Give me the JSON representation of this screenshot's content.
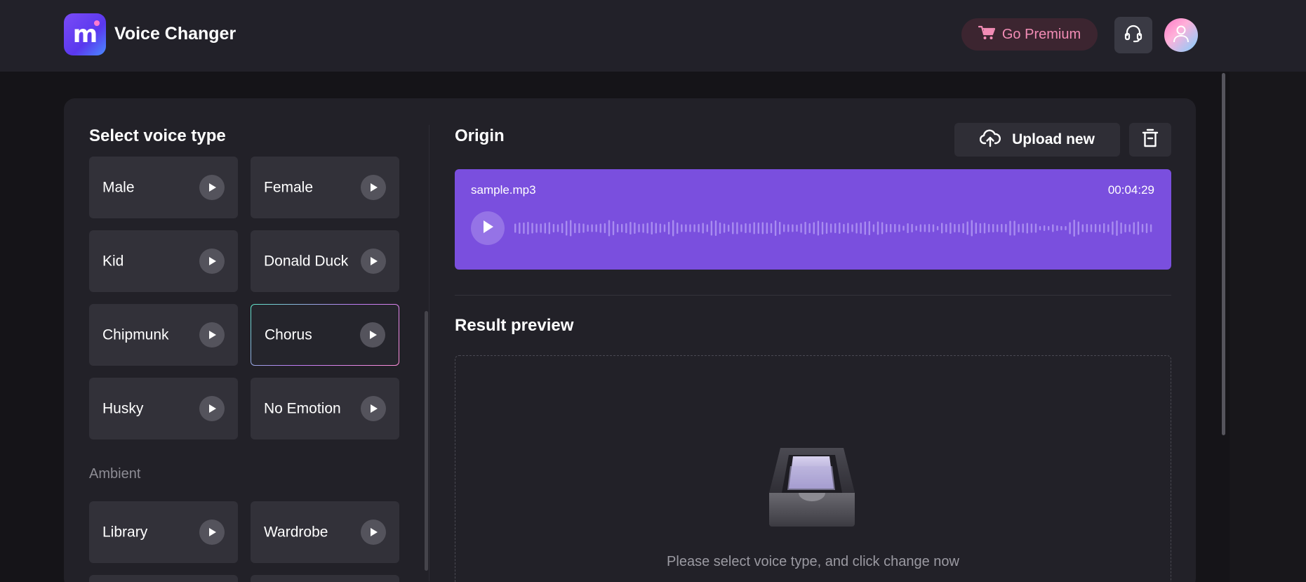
{
  "header": {
    "logo_letter": "m",
    "app_title": "Voice Changer",
    "premium_label": "Go Premium",
    "icons": {
      "cart": "cart-icon",
      "support": "headset-icon",
      "avatar": "user-icon"
    },
    "colors": {
      "accent": "#7a4fde",
      "premium_text": "#f28cb5"
    }
  },
  "left": {
    "title": "Select voice type",
    "voices": [
      {
        "label": "Male"
      },
      {
        "label": "Female"
      },
      {
        "label": "Kid"
      },
      {
        "label": "Donald Duck"
      },
      {
        "label": "Chipmunk"
      },
      {
        "label": "Chorus",
        "selected": true
      },
      {
        "label": "Husky"
      },
      {
        "label": "No Emotion"
      }
    ],
    "ambient_title": "Ambient",
    "ambient": [
      {
        "label": "Library"
      },
      {
        "label": "Wardrobe"
      }
    ]
  },
  "origin": {
    "title": "Origin",
    "upload_label": "Upload new",
    "file_name": "sample.mp3",
    "duration": "00:04:29"
  },
  "result": {
    "title": "Result preview",
    "hint": "Please select voice type, and click change now"
  }
}
